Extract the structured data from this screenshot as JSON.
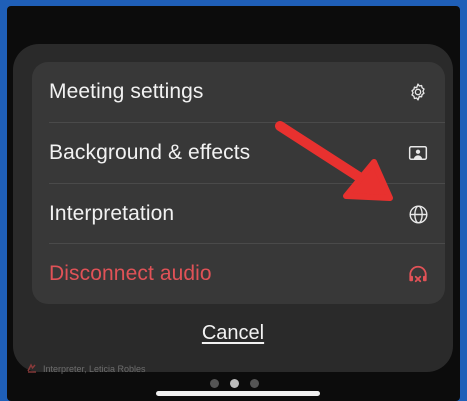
{
  "menu": {
    "items": [
      {
        "label": "Meeting settings",
        "icon": "gear-icon"
      },
      {
        "label": "Background & effects",
        "icon": "background-icon"
      },
      {
        "label": "Interpretation",
        "icon": "globe-icon"
      },
      {
        "label": "Disconnect audio",
        "icon": "disconnect-audio-icon"
      }
    ]
  },
  "cancel_label": "Cancel",
  "behind": {
    "participant_text": "Interpreter, Leticia Robles"
  },
  "pager": {
    "count": 3,
    "active_index": 1
  },
  "colors": {
    "background_border": "#1f5fb8",
    "sheet": "#2a2a2a",
    "menu": "#383838",
    "danger": "#e05257",
    "annotation_arrow": "#e8312f"
  }
}
